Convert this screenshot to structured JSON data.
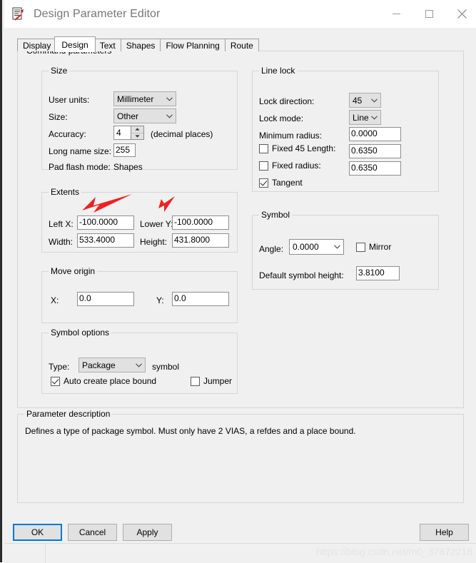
{
  "window": {
    "title": "Design Parameter Editor",
    "app_icon": "design-parameter-editor-icon",
    "controls": {
      "minimize": "minimize-icon",
      "maximize": "maximize-icon",
      "close": "close-icon"
    }
  },
  "tabs": [
    {
      "label": "Display",
      "selected": false
    },
    {
      "label": "Design",
      "selected": true
    },
    {
      "label": "Text",
      "selected": false
    },
    {
      "label": "Shapes",
      "selected": false
    },
    {
      "label": "Flow Planning",
      "selected": false
    },
    {
      "label": "Route",
      "selected": false
    }
  ],
  "command_parameters": {
    "title": "Command parameters",
    "size": {
      "title": "Size",
      "user_units_label": "User units:",
      "user_units_value": "Millimeter",
      "size_label": "Size:",
      "size_value": "Other",
      "accuracy_label": "Accuracy:",
      "accuracy_value": "4",
      "accuracy_suffix": "(decimal places)",
      "long_name_size_label": "Long name size:",
      "long_name_size_value": "255",
      "pad_flash_mode_label": "Pad flash mode:",
      "pad_flash_mode_value": "Shapes"
    },
    "line_lock": {
      "title": "Line lock",
      "lock_direction_label": "Lock direction:",
      "lock_direction_value": "45",
      "lock_mode_label": "Lock mode:",
      "lock_mode_value": "Line",
      "minimum_radius_label": "Minimum radius:",
      "minimum_radius_value": "0.0000",
      "fixed_45_length_label": "Fixed 45 Length:",
      "fixed_45_length_checked": false,
      "fixed_45_length_value": "0.6350",
      "fixed_radius_label": "Fixed radius:",
      "fixed_radius_checked": false,
      "fixed_radius_value": "0.6350",
      "tangent_label": "Tangent",
      "tangent_checked": true
    },
    "extents": {
      "title": "Extents",
      "left_x_label": "Left X:",
      "left_x_value": "-100.0000",
      "lower_y_label": "Lower Y:",
      "lower_y_value": "-100.0000",
      "width_label": "Width:",
      "width_value": "533.4000",
      "height_label": "Height:",
      "height_value": "431.8000"
    },
    "symbol": {
      "title": "Symbol",
      "angle_label": "Angle:",
      "angle_value": "0.0000",
      "mirror_label": "Mirror",
      "mirror_checked": false,
      "default_symbol_height_label": "Default symbol height:",
      "default_symbol_height_value": "3.8100"
    },
    "move_origin": {
      "title": "Move origin",
      "x_label": "X:",
      "x_value": "0.0",
      "y_label": "Y:",
      "y_value": "0.0"
    },
    "symbol_options": {
      "title": "Symbol options",
      "type_label": "Type:",
      "type_value": "Package",
      "type_suffix": "symbol",
      "auto_create_label": "Auto create place bound",
      "auto_create_checked": true,
      "jumper_label": "Jumper",
      "jumper_checked": false
    }
  },
  "parameter_description": {
    "title": "Parameter description",
    "text": "Defines a type of package symbol.  Must only have 2 VIAS, a refdes and a place bound."
  },
  "buttons": {
    "ok": "OK",
    "cancel": "Cancel",
    "apply": "Apply",
    "help": "Help"
  },
  "watermark": "https://blog.csdn.net/m0_37872218",
  "annotations": {
    "arrow_color": "#ee2222",
    "arrow_1_target": "left-x-field",
    "arrow_2_target": "lower-y-field"
  }
}
